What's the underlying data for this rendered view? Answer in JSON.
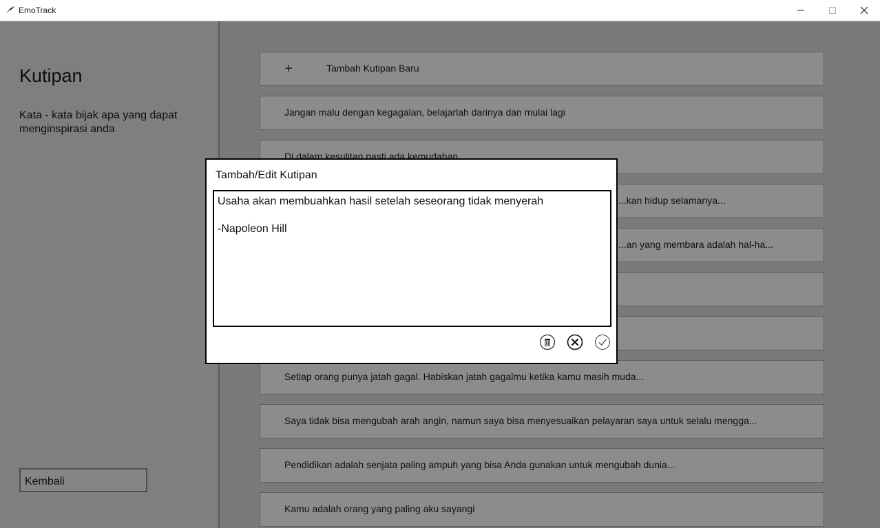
{
  "window": {
    "title": "EmoTrack"
  },
  "sidebar": {
    "title": "Kutipan",
    "subtitle": "Kata - kata bijak apa yang dapat menginspirasi anda",
    "back_label": "Kembali"
  },
  "main": {
    "add": {
      "icon_text": "+",
      "label": "Tambah Kutipan Baru"
    },
    "quotes": [
      "Jangan malu dengan kegagalan, belajarlah darinya dan mulai lagi",
      "Di dalam kesulitan pasti ada kemudahan",
      "...kan hidup selamanya...",
      "...an yang membara adalah hal-ha...",
      "",
      "",
      "Setiap orang punya jatah gagal. Habiskan jatah gagalmu ketika kamu masih muda...",
      "Saya tidak bisa mengubah arah angin, namun saya bisa menyesuaikan pelayaran saya untuk selalu mengga...",
      "Pendidikan adalah senjata paling ampuh yang bisa Anda gunakan untuk mengubah dunia...",
      "Kamu adalah orang yang paling aku sayangi"
    ]
  },
  "dialog": {
    "title": "Tambah/Edit Kutipan",
    "text_lines": [
      "Usaha akan membuahkan hasil setelah seseorang tidak menyerah",
      "",
      "-Napoleon Hill"
    ],
    "icons": [
      "trash-icon",
      "cancel-icon",
      "confirm-icon"
    ]
  }
}
